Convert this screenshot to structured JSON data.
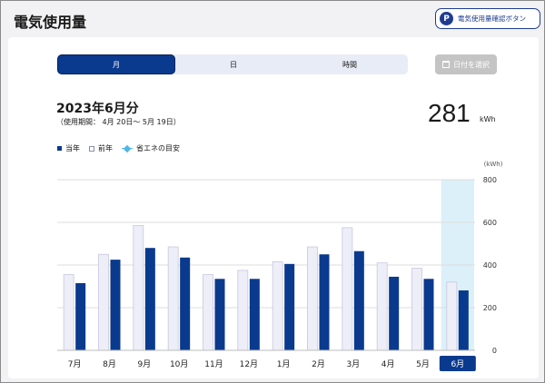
{
  "header": {
    "title": "電気使用量",
    "guide_button_icon": "P",
    "guide_button_label": "電気使用量確認ボタン"
  },
  "tabs": [
    {
      "label": "月",
      "active": true
    },
    {
      "label": "日",
      "active": false
    },
    {
      "label": "時間",
      "active": false
    }
  ],
  "date_button_label": "日付を選択",
  "period": {
    "title": "2023年6月分",
    "subtitle": "（使用期間： 4月 20日～ 5月 19日）"
  },
  "usage": {
    "value": "281",
    "unit": "kWh"
  },
  "legend": {
    "current": "当年",
    "previous": "前年",
    "target": "省エネの目安"
  },
  "colors": {
    "current": "#0a3a8e",
    "previous": "#eeeef8",
    "previous_border": "#c6c7de",
    "highlight": "#dcf0f9",
    "target": "#4fb6e6"
  },
  "chart_data": {
    "type": "bar",
    "unit_label": "(kWh)",
    "categories": [
      "7月",
      "8月",
      "9月",
      "10月",
      "11月",
      "12月",
      "1月",
      "2月",
      "3月",
      "4月",
      "5月",
      "6月"
    ],
    "series": [
      {
        "name": "前年",
        "values": [
          355,
          450,
          585,
          485,
          355,
          375,
          415,
          485,
          575,
          410,
          385,
          320
        ]
      },
      {
        "name": "当年",
        "values": [
          315,
          425,
          480,
          435,
          335,
          335,
          405,
          450,
          465,
          345,
          335,
          281
        ]
      }
    ],
    "ylim": [
      0,
      800
    ],
    "yticks": [
      0,
      200,
      400,
      600,
      800
    ],
    "highlighted_category": "6月",
    "grid": true
  }
}
